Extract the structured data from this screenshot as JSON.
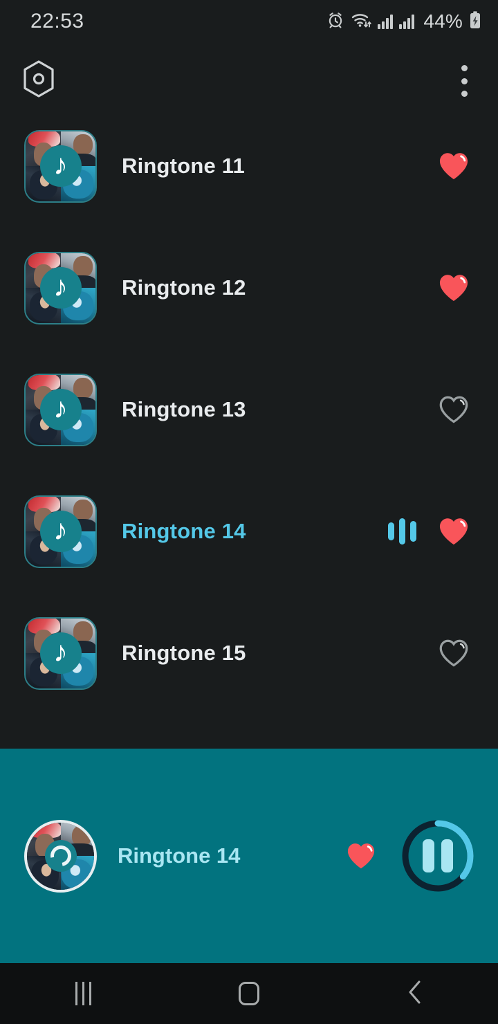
{
  "status_bar": {
    "time": "22:53",
    "battery_text": "44%",
    "icons": [
      "alarm-icon",
      "wifi-icon",
      "signal-icon",
      "signal-icon",
      "battery-charging-icon"
    ]
  },
  "app_bar": {
    "logo_icon": "hexagon-app-logo-icon",
    "overflow_icon": "more-vertical-icon"
  },
  "theme": {
    "background": "#191c1d",
    "accent_teal": "#02737f",
    "accent_cyan": "#54c8e8",
    "favorite_red": "#f9555a",
    "text_primary": "#e9ecee",
    "text_player": "#a9e6f2"
  },
  "list": {
    "items": [
      {
        "title": "Ringtone 11",
        "favorite": true,
        "playing": false
      },
      {
        "title": "Ringtone 12",
        "favorite": true,
        "playing": false
      },
      {
        "title": "Ringtone 13",
        "favorite": false,
        "playing": false
      },
      {
        "title": "Ringtone 14",
        "favorite": true,
        "playing": true
      },
      {
        "title": "Ringtone 15",
        "favorite": false,
        "playing": false
      }
    ]
  },
  "player": {
    "title": "Ringtone 14",
    "favorite": true,
    "state": "playing",
    "button_icon": "pause-icon",
    "progress_percent": 36
  },
  "nav_bar": {
    "recents_label": "recents-icon",
    "home_label": "home-icon",
    "back_label": "back-icon"
  }
}
